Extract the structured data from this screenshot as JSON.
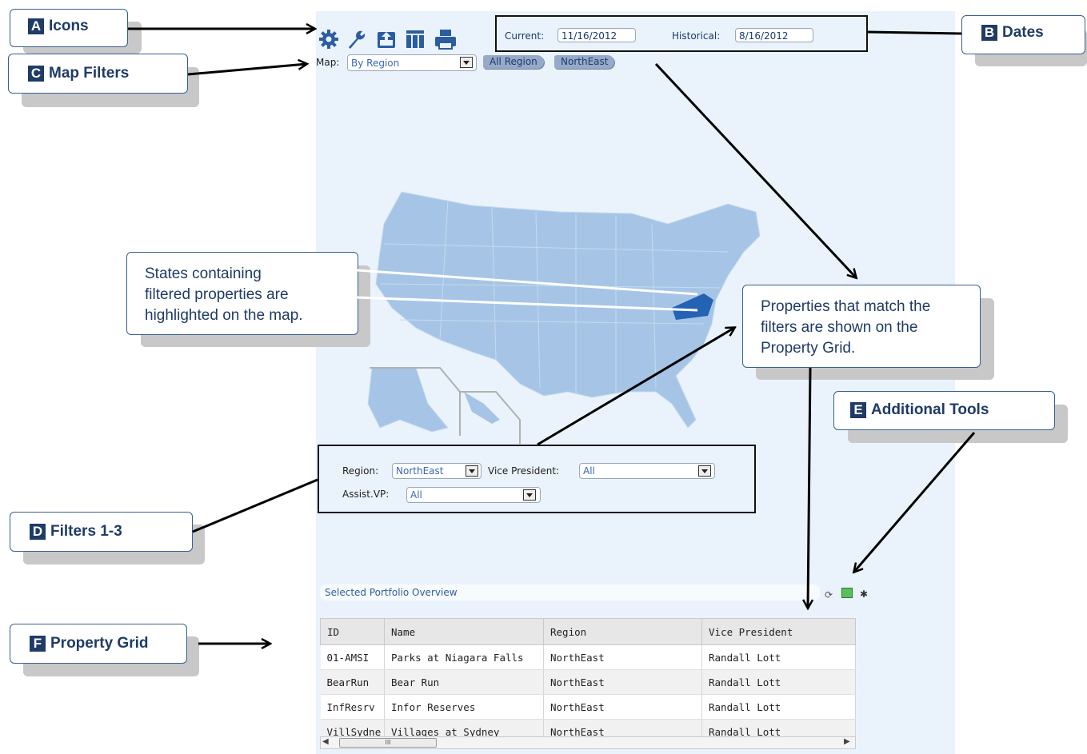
{
  "dates": {
    "current_label": "Current:",
    "current_value": "11/16/2012",
    "historical_label": "Historical:",
    "historical_value": "8/16/2012"
  },
  "map_filter": {
    "label": "Map:",
    "selected": "By Region",
    "breadcrumbs": [
      "All Region",
      "NorthEast"
    ]
  },
  "filters": {
    "region_label": "Region:",
    "region_value": "NorthEast",
    "vp_label": "Vice President:",
    "vp_value": "All",
    "avp_label": "Assist.VP:",
    "avp_value": "All"
  },
  "overview_title": "Selected Portfolio Overview",
  "grid": {
    "columns": [
      "ID",
      "Name",
      "Region",
      "Vice President"
    ],
    "rows": [
      [
        "01-AMSI",
        "Parks at Niagara Falls",
        "NorthEast",
        "Randall Lott"
      ],
      [
        "BearRun",
        "Bear Run",
        "NorthEast",
        "Randall Lott"
      ],
      [
        "InfResrv",
        "Infor Reserves",
        "NorthEast",
        "Randall Lott"
      ],
      [
        "VillSydne",
        "Villages at Sydney",
        "NorthEast",
        "Randall Lott"
      ]
    ],
    "scroll_thumb": "III"
  },
  "callouts": {
    "a": {
      "letter": "A",
      "text": "Icons"
    },
    "b": {
      "letter": "B",
      "text": "Dates"
    },
    "c": {
      "letter": "C",
      "text": "Map Filters"
    },
    "d": {
      "letter": "D",
      "text": "Filters 1-3"
    },
    "e": {
      "letter": "E",
      "text": "Additional Tools"
    },
    "f": {
      "letter": "F",
      "text": "Property Grid"
    }
  },
  "notes": {
    "states": [
      "States containing",
      "filtered properties are",
      "highlighted on the map."
    ],
    "grid": [
      "Properties that match the",
      "filters are shown on the",
      "Property Grid."
    ]
  },
  "toolbar_icons": [
    "gear-icon",
    "wrench-icon",
    "upload-icon",
    "columns-icon",
    "print-icon"
  ],
  "colors": {
    "accent": "#1f3b66",
    "panel": "#eaf3fc",
    "map_state": "#a6c5e6",
    "map_highlight": "#2463b4"
  }
}
